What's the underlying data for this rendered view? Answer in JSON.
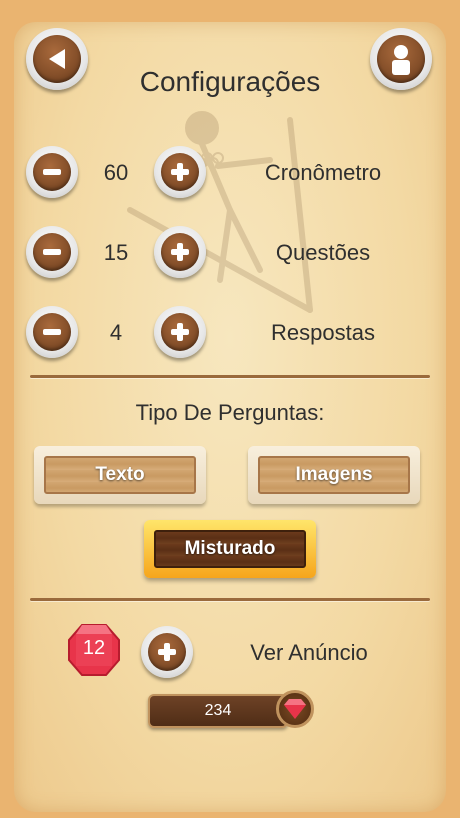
{
  "title": "Configurações",
  "settings": [
    {
      "value": "60",
      "label": "Cronômetro"
    },
    {
      "value": "15",
      "label": "Questões"
    },
    {
      "value": "4",
      "label": "Respostas"
    }
  ],
  "question_type": {
    "heading": "Tipo De Perguntas:",
    "options": [
      "Texto",
      "Imagens",
      "Misturado"
    ],
    "selected": "Misturado"
  },
  "ad": {
    "gem_count": "12",
    "label": "Ver Anúncio"
  },
  "currency": {
    "amount": "234"
  },
  "icons": {
    "back": "back-arrow-icon",
    "profile": "user-icon",
    "minus": "minus-icon",
    "plus": "plus-icon",
    "gem": "gem-icon"
  },
  "colors": {
    "background": "#eab470",
    "panel": "#f5dfb0",
    "wood": "#86502a",
    "selected_border": "#f6a51c",
    "gem": "#e8344a"
  }
}
